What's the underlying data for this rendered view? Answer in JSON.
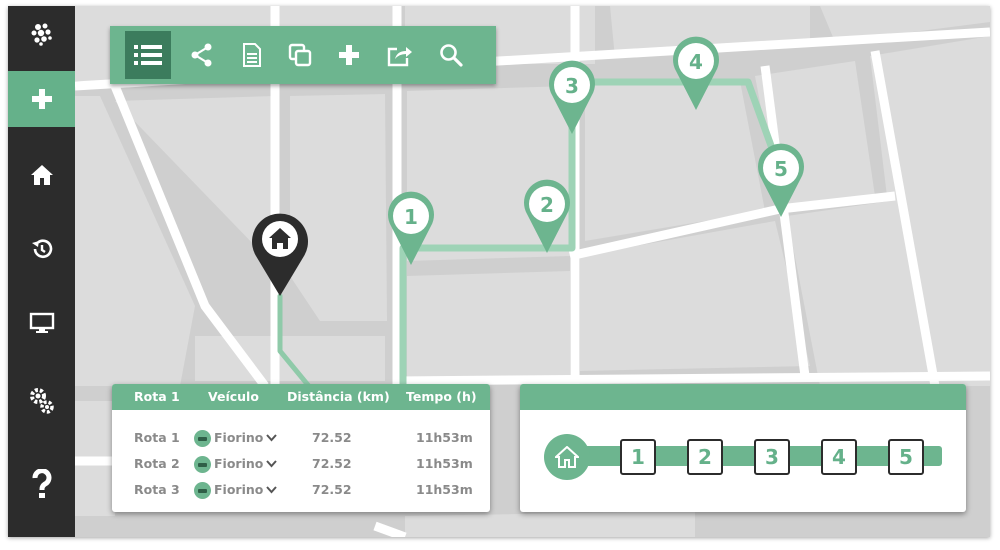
{
  "sidebar": {
    "logo_icon": "cluster-logo-icon",
    "items": [
      {
        "icon": "plus-icon",
        "active": true
      },
      {
        "icon": "home-icon",
        "active": false
      },
      {
        "icon": "history-icon",
        "active": false
      },
      {
        "icon": "monitor-icon",
        "active": false
      },
      {
        "icon": "gears-icon",
        "active": false
      },
      {
        "icon": "help-icon",
        "active": false
      }
    ]
  },
  "toolbar": {
    "buttons": [
      "list-icon",
      "share-icon",
      "document-icon",
      "copy-icon",
      "plus-icon",
      "export-icon",
      "search-icon"
    ],
    "active": "list-icon"
  },
  "map": {
    "home_marker": "home-icon",
    "markers": [
      "1",
      "2",
      "3",
      "4",
      "5"
    ]
  },
  "routes_table": {
    "headers": [
      "Rota 1",
      "Veículo",
      "Distância (km)",
      "Tempo (h)"
    ],
    "rows": [
      {
        "route": "Rota 1",
        "vehicle": "Fiorino",
        "distance": "72.52",
        "time": "11h53m"
      },
      {
        "route": "Rota 2",
        "vehicle": "Fiorino",
        "distance": "72.52",
        "time": "11h53m"
      },
      {
        "route": "Rota 3",
        "vehicle": "Fiorino",
        "distance": "72.52",
        "time": "11h53m"
      }
    ]
  },
  "steps": {
    "start_icon": "home-icon",
    "items": [
      "1",
      "2",
      "3",
      "4",
      "5"
    ]
  },
  "colors": {
    "accent": "#6db58f",
    "accent_dark": "#3c7c5d",
    "sidebar": "#2c2c2c",
    "map_block": "#dcdcdc",
    "road": "#ffffff"
  }
}
